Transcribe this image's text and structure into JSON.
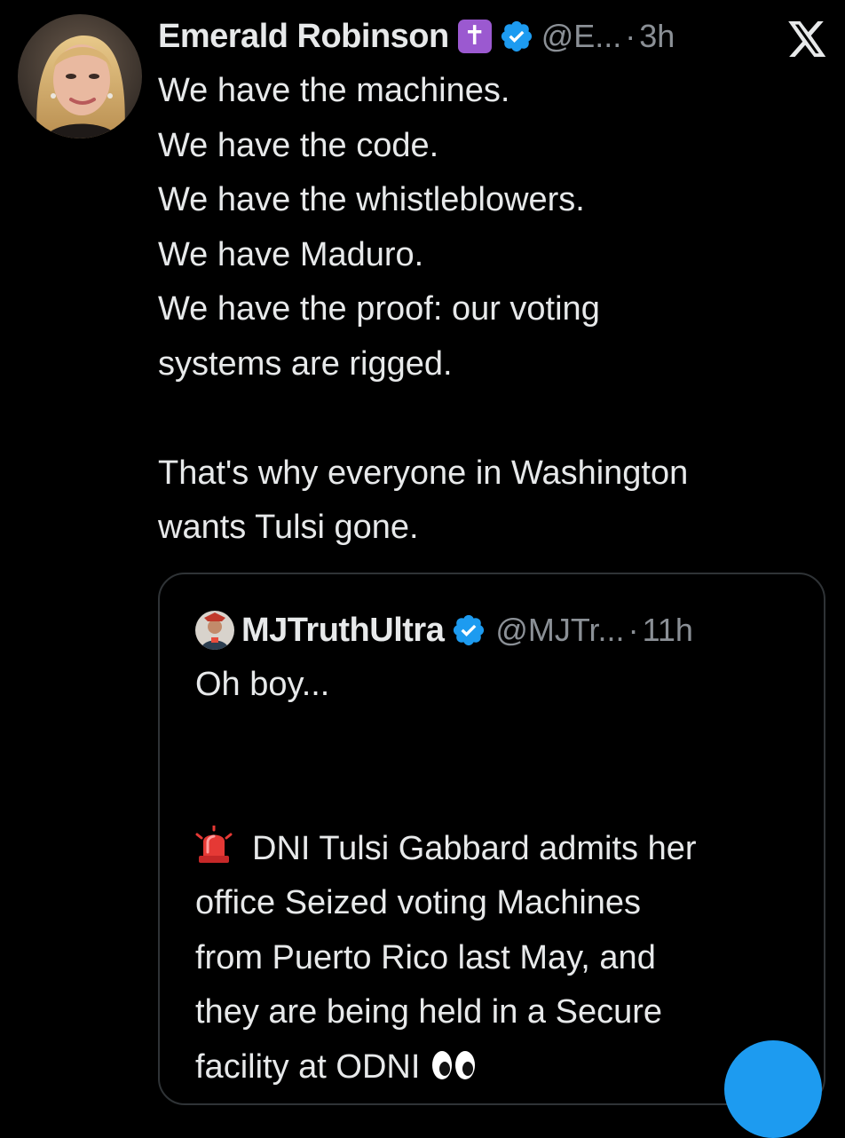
{
  "colors": {
    "background": "#000000",
    "text_primary": "#e7e9ea",
    "text_secondary": "#8b9096",
    "verified_blue": "#1d9bf0",
    "quote_border": "#2f3336",
    "badge_purple": "#9b59d0"
  },
  "tweet": {
    "author_name": "Emerald Robinson",
    "badge_glyph": "✝",
    "badge_icon": "latin-cross-icon",
    "verified_icon": "verified-badge-icon",
    "handle": "@E...",
    "separator": "·",
    "time": "3h",
    "platform_icon": "x-logo-icon",
    "lines": [
      "We have the machines.",
      "We have the code.",
      "We have the whistleblowers.",
      "We have Maduro.",
      "We have the proof: our voting",
      "systems are rigged."
    ],
    "lines_2": [
      "That's why everyone in Washington",
      "wants Tulsi gone."
    ]
  },
  "quote": {
    "author_name": "MJTruthUltra",
    "verified_icon": "verified-badge-icon",
    "handle": "@MJTr...",
    "separator": "·",
    "time": "11h",
    "line_1": "Oh boy...",
    "siren_icon": "police-light-icon",
    "lines": [
      "DNI Tulsi Gabbard admits her",
      "office Seized voting Machines",
      "from Puerto Rico last May, and",
      "they are being held in a Secure",
      "facility at ODNI"
    ],
    "eyes_icon": "eyes-icon"
  },
  "fab_icon": "compose-button"
}
